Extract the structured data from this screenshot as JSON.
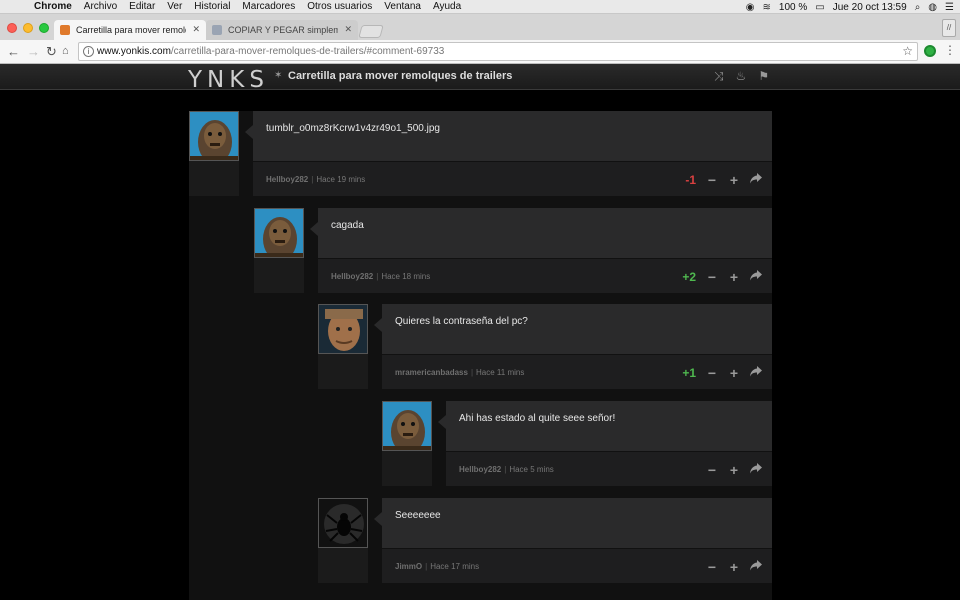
{
  "menubar": {
    "app": "Chrome",
    "items": [
      "Archivo",
      "Editar",
      "Ver",
      "Historial",
      "Marcadores",
      "Otros usuarios",
      "Ventana",
      "Ayuda"
    ],
    "battery": "100 %",
    "datetime": "Jue 20 oct  13:59"
  },
  "tabs": [
    {
      "title": "Carretilla para mover remolques",
      "active": true
    },
    {
      "title": "COPIAR Y PEGAR simplemente",
      "active": false
    }
  ],
  "toolbar": {
    "url_domain": "www.yonkis.com",
    "url_path": "/carretilla-para-mover-remolques-de-trailers/#comment-69733",
    "profile_label": "//"
  },
  "site": {
    "logo": "YNKS",
    "title": "Carretilla para mover remolques de trailers"
  },
  "comments": [
    {
      "id": "c1",
      "text": "tumblr_o0mz8rKcrw1v4zr49o1_500.jpg",
      "user": "Hellboy282",
      "time": "Hace 19 mins",
      "score": "-1",
      "score_type": "neg",
      "avatar": "chewbacca"
    },
    {
      "id": "c2",
      "text": "cagada",
      "user": "Hellboy282",
      "time": "Hace 18 mins",
      "score": "+2",
      "score_type": "pos",
      "avatar": "chewbacca"
    },
    {
      "id": "c3",
      "text": "Quieres la contraseña del pc?",
      "user": "mramericanbadass",
      "time": "Hace 11 mins",
      "score": "+1",
      "score_type": "pos",
      "avatar": "oldman"
    },
    {
      "id": "c4",
      "text": "Ahi has estado al quite seee señor!",
      "user": "Hellboy282",
      "time": "Hace 5 mins",
      "score": "",
      "score_type": "none",
      "avatar": "chewbacca"
    },
    {
      "id": "c5",
      "text": "Seeeeeee",
      "user": "JimmO",
      "time": "Hace 17 mins",
      "score": "",
      "score_type": "none",
      "avatar": "spider"
    }
  ],
  "labels": {
    "minus": "−",
    "plus": "+",
    "sep": "|"
  },
  "colors": {
    "negative": "#d94040",
    "positive": "#4fb84f",
    "bubble": "#2a2a2b"
  }
}
